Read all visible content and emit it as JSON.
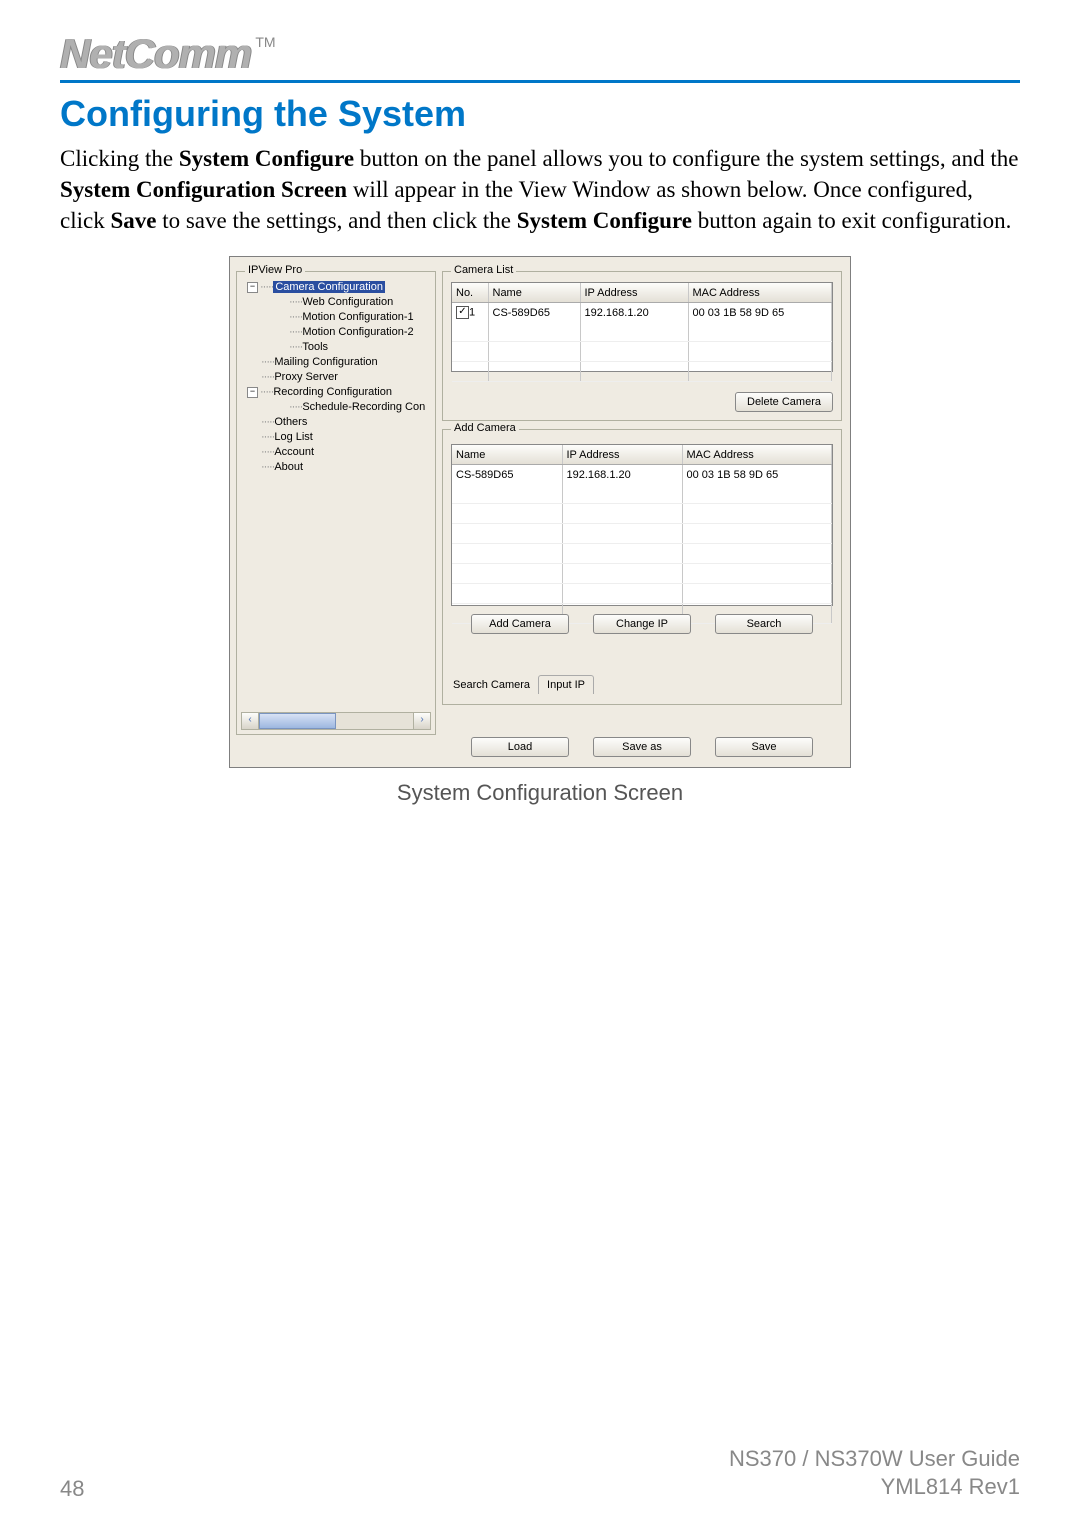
{
  "brand": {
    "name": "NetComm",
    "tm": "TM"
  },
  "heading": "Configuring the System",
  "paragraph": {
    "pre1": "Clicking the ",
    "b1": "System Configure",
    "mid1": " button on the panel allows you to configure the system settings, and the ",
    "b2": "System Configuration Screen",
    "mid2": " will appear in the View Window as shown below.  Once configured, click ",
    "b3": "Save",
    "mid3": " to save the settings, and then click the ",
    "b4": "System Configure",
    "post": " button again to exit configuration."
  },
  "tree": {
    "legend": "IPView Pro",
    "items": [
      {
        "indent": 0,
        "expander": "−",
        "label": "Camera Configuration",
        "selected": true
      },
      {
        "indent": 1,
        "label": "Web Configuration"
      },
      {
        "indent": 1,
        "label": "Motion Configuration-1"
      },
      {
        "indent": 1,
        "label": "Motion Configuration-2"
      },
      {
        "indent": 1,
        "label": "Tools"
      },
      {
        "indent": 0,
        "label": "Mailing Configuration"
      },
      {
        "indent": 0,
        "label": "Proxy Server"
      },
      {
        "indent": 0,
        "expander": "−",
        "label": "Recording Configuration"
      },
      {
        "indent": 1,
        "label": "Schedule-Recording Con"
      },
      {
        "indent": 0,
        "label": "Others"
      },
      {
        "indent": 0,
        "label": "Log List"
      },
      {
        "indent": 0,
        "label": "Account"
      },
      {
        "indent": 0,
        "label": "About"
      }
    ]
  },
  "cameraList": {
    "legend": "Camera List",
    "headers": {
      "no": "No.",
      "name": "Name",
      "ip": "IP Address",
      "mac": "MAC Address"
    },
    "rows": [
      {
        "checked": true,
        "no": "1",
        "name": "CS-589D65",
        "ip": "192.168.1.20",
        "mac": "00 03 1B 58 9D 65"
      }
    ],
    "deleteBtn": "Delete Camera"
  },
  "addCamera": {
    "legend": "Add Camera",
    "headers": {
      "name": "Name",
      "ip": "IP Address",
      "mac": "MAC Address"
    },
    "rows": [
      {
        "name": "CS-589D65",
        "ip": "192.168.1.20",
        "mac": "00 03 1B 58 9D 65"
      }
    ],
    "buttons": {
      "add": "Add Camera",
      "changeIp": "Change IP",
      "search": "Search"
    },
    "tabLabel": "Search Camera",
    "tabs": {
      "inputIp": "Input IP"
    }
  },
  "bottomButtons": {
    "load": "Load",
    "saveAs": "Save as",
    "save": "Save"
  },
  "caption": "System Configuration Screen",
  "footer": {
    "pageNumber": "48",
    "guide": "NS370 / NS370W User Guide",
    "rev": "YML814 Rev1"
  }
}
